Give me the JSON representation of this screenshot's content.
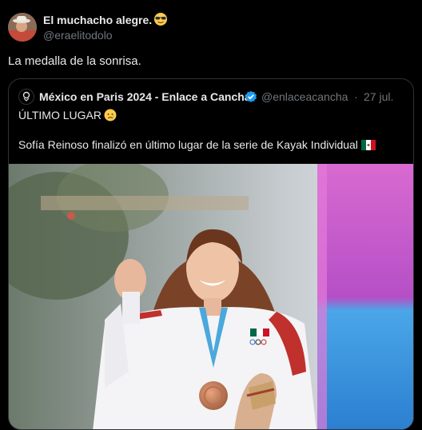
{
  "author": {
    "name": "El muchacho alegre.",
    "emoji": "sunglasses-face-emoji",
    "handle": "@eraelitodolo"
  },
  "tweet_text": "La medalla de la sonrisa.",
  "quote": {
    "name": "México en Paris 2024 - Enlace a Cancha",
    "verified": true,
    "handle": "@enlaceacancha",
    "separator": "·",
    "date": "27 jul.",
    "line1": "ÚLTIMO LUGAR",
    "line1_emoji": "sad-face-emoji",
    "line2": "Sofía Reinoso finalizó en último lugar de la serie de Kayak Individual",
    "line2_flag": "mexico-flag-emoji",
    "image": "athlete-with-bronze-medal-photo"
  },
  "colors": {
    "background": "#000000",
    "text": "#e7e9ea",
    "secondary_text": "#71767b",
    "verified_blue": "#1d9bf0",
    "border": "#2f3336"
  }
}
